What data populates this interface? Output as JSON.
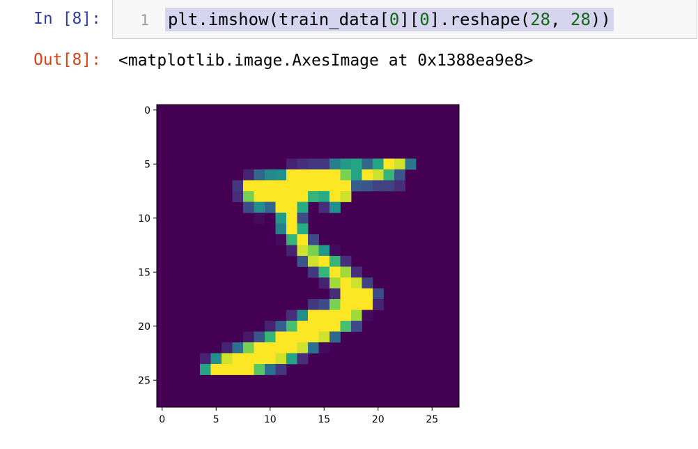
{
  "cell": {
    "in_prompt": "In [8]:",
    "line_number": "1",
    "code_tokens": [
      {
        "t": "plt.imshow(train_data[",
        "c": ""
      },
      {
        "t": "0",
        "c": "num"
      },
      {
        "t": "][",
        "c": ""
      },
      {
        "t": "0",
        "c": "num"
      },
      {
        "t": "].reshape(",
        "c": ""
      },
      {
        "t": "28",
        "c": "num"
      },
      {
        "t": ", ",
        "c": ""
      },
      {
        "t": "28",
        "c": "num"
      },
      {
        "t": "))",
        "c": ""
      }
    ],
    "out_prompt": "Out[8]:",
    "output_text": "<matplotlib.image.AxesImage at 0x1388ea9e8>"
  },
  "colors": {
    "in_prompt": "#303F9F",
    "out_prompt": "#D84315",
    "code_bg": "#f7f7f7",
    "selection": "#d7d4f0",
    "number": "#116611"
  },
  "chart_data": {
    "type": "heatmap",
    "colormap": "viridis",
    "rows": 28,
    "cols": 28,
    "xticks": [
      "0",
      "5",
      "10",
      "15",
      "20",
      "25"
    ],
    "yticks": [
      "0",
      "5",
      "10",
      "15",
      "20",
      "25"
    ],
    "xlim": [
      -0.5,
      27.5
    ],
    "ylim": [
      27.5,
      -0.5
    ],
    "pixel_rows": [
      "............................",
      "............................",
      "............................",
      "............................",
      "............................",
      "............................",
      "...............................",
      "............................",
      "............................",
      "............................",
      "............................",
      "............................",
      "............................",
      "............................",
      "............................",
      "............................",
      "............................",
      "............................",
      "............................",
      "............................",
      "............................",
      "............................",
      "............................",
      "............................",
      "............................",
      "............................",
      "............................",
      "............................"
    ],
    "values": [
      [
        0,
        0,
        0,
        0,
        0,
        0,
        0,
        0,
        0,
        0,
        0,
        0,
        0,
        0,
        0,
        0,
        0,
        0,
        0,
        0,
        0,
        0,
        0,
        0,
        0,
        0,
        0,
        0
      ],
      [
        0,
        0,
        0,
        0,
        0,
        0,
        0,
        0,
        0,
        0,
        0,
        0,
        0,
        0,
        0,
        0,
        0,
        0,
        0,
        0,
        0,
        0,
        0,
        0,
        0,
        0,
        0,
        0
      ],
      [
        0,
        0,
        0,
        0,
        0,
        0,
        0,
        0,
        0,
        0,
        0,
        0,
        0,
        0,
        0,
        0,
        0,
        0,
        0,
        0,
        0,
        0,
        0,
        0,
        0,
        0,
        0,
        0
      ],
      [
        0,
        0,
        0,
        0,
        0,
        0,
        0,
        0,
        0,
        0,
        0,
        0,
        0,
        0,
        0,
        0,
        0,
        0,
        0,
        0,
        0,
        0,
        0,
        0,
        0,
        0,
        0,
        0
      ],
      [
        0,
        0,
        0,
        0,
        0,
        0,
        0,
        0,
        0,
        0,
        0,
        0,
        0,
        0,
        0,
        0,
        0,
        0,
        0,
        0,
        0,
        0,
        0,
        0,
        0,
        0,
        0,
        0
      ],
      [
        0,
        0,
        0,
        0,
        0,
        0,
        0,
        0,
        0,
        0,
        0,
        0,
        3,
        4,
        5,
        5,
        13,
        16,
        17,
        10,
        17,
        25,
        24,
        12,
        0,
        0,
        0,
        0
      ],
      [
        0,
        0,
        0,
        0,
        0,
        0,
        0,
        0,
        3,
        10,
        14,
        15,
        25,
        25,
        25,
        25,
        25,
        22,
        17,
        25,
        24,
        19,
        8,
        0,
        0,
        0,
        0,
        0
      ],
      [
        0,
        0,
        0,
        0,
        0,
        0,
        0,
        5,
        25,
        25,
        25,
        25,
        25,
        25,
        25,
        25,
        25,
        25,
        9,
        8,
        6,
        6,
        4,
        0,
        0,
        0,
        0,
        0
      ],
      [
        0,
        0,
        0,
        0,
        0,
        0,
        0,
        4,
        22,
        25,
        25,
        25,
        25,
        25,
        19,
        18,
        25,
        24,
        0,
        0,
        0,
        0,
        0,
        0,
        0,
        0,
        0,
        0
      ],
      [
        0,
        0,
        0,
        0,
        0,
        0,
        0,
        0,
        7,
        15,
        10,
        25,
        25,
        18,
        0,
        4,
        15,
        0,
        0,
        0,
        0,
        0,
        0,
        0,
        0,
        0,
        0,
        0
      ],
      [
        0,
        0,
        0,
        0,
        0,
        0,
        0,
        0,
        0,
        1,
        0,
        16,
        25,
        7,
        0,
        0,
        0,
        0,
        0,
        0,
        0,
        0,
        0,
        0,
        0,
        0,
        0,
        0
      ],
      [
        0,
        0,
        0,
        0,
        0,
        0,
        0,
        0,
        0,
        0,
        0,
        13,
        25,
        18,
        0,
        0,
        0,
        0,
        0,
        0,
        0,
        0,
        0,
        0,
        0,
        0,
        0,
        0
      ],
      [
        0,
        0,
        0,
        0,
        0,
        0,
        0,
        0,
        0,
        0,
        0,
        1,
        19,
        25,
        7,
        0,
        0,
        0,
        0,
        0,
        0,
        0,
        0,
        0,
        0,
        0,
        0,
        0
      ],
      [
        0,
        0,
        0,
        0,
        0,
        0,
        0,
        0,
        0,
        0,
        0,
        0,
        3,
        24,
        22,
        16,
        1,
        0,
        0,
        0,
        0,
        0,
        0,
        0,
        0,
        0,
        0,
        0
      ],
      [
        0,
        0,
        0,
        0,
        0,
        0,
        0,
        0,
        0,
        0,
        0,
        0,
        0,
        8,
        24,
        25,
        19,
        4,
        0,
        0,
        0,
        0,
        0,
        0,
        0,
        0,
        0,
        0
      ],
      [
        0,
        0,
        0,
        0,
        0,
        0,
        0,
        0,
        0,
        0,
        0,
        0,
        0,
        0,
        5,
        19,
        25,
        23,
        4,
        0,
        0,
        0,
        0,
        0,
        0,
        0,
        0,
        0
      ],
      [
        0,
        0,
        0,
        0,
        0,
        0,
        0,
        0,
        0,
        0,
        0,
        0,
        0,
        0,
        0,
        3,
        23,
        25,
        24,
        6,
        0,
        0,
        0,
        0,
        0,
        0,
        0,
        0
      ],
      [
        0,
        0,
        0,
        0,
        0,
        0,
        0,
        0,
        0,
        0,
        0,
        0,
        0,
        0,
        0,
        0,
        4,
        25,
        25,
        25,
        7,
        0,
        0,
        0,
        0,
        0,
        0,
        0
      ],
      [
        0,
        0,
        0,
        0,
        0,
        0,
        0,
        0,
        0,
        0,
        0,
        0,
        0,
        0,
        5,
        7,
        22,
        25,
        25,
        25,
        3,
        0,
        0,
        0,
        0,
        0,
        0,
        0
      ],
      [
        0,
        0,
        0,
        0,
        0,
        0,
        0,
        0,
        0,
        0,
        0,
        0,
        4,
        15,
        25,
        25,
        25,
        25,
        23,
        1,
        0,
        0,
        0,
        0,
        0,
        0,
        0,
        0
      ],
      [
        0,
        0,
        0,
        0,
        0,
        0,
        0,
        0,
        0,
        0,
        3,
        9,
        20,
        25,
        25,
        25,
        25,
        20,
        7,
        0,
        0,
        0,
        0,
        0,
        0,
        0,
        0,
        0
      ],
      [
        0,
        0,
        0,
        0,
        0,
        0,
        0,
        0,
        2,
        8,
        19,
        25,
        25,
        25,
        25,
        24,
        10,
        0,
        0,
        0,
        0,
        0,
        0,
        0,
        0,
        0,
        0,
        0
      ],
      [
        0,
        0,
        0,
        0,
        0,
        0,
        3,
        11,
        22,
        25,
        25,
        25,
        25,
        24,
        11,
        1,
        0,
        0,
        0,
        0,
        0,
        0,
        0,
        0,
        0,
        0,
        0,
        0
      ],
      [
        0,
        0,
        0,
        0,
        3,
        15,
        24,
        25,
        25,
        25,
        25,
        24,
        17,
        4,
        0,
        0,
        0,
        0,
        0,
        0,
        0,
        0,
        0,
        0,
        0,
        0,
        0,
        0
      ],
      [
        0,
        0,
        0,
        0,
        17,
        25,
        25,
        25,
        25,
        21,
        11,
        5,
        0,
        0,
        0,
        0,
        0,
        0,
        0,
        0,
        0,
        0,
        0,
        0,
        0,
        0,
        0,
        0
      ],
      [
        0,
        0,
        0,
        0,
        0,
        0,
        0,
        0,
        0,
        0,
        0,
        0,
        0,
        0,
        0,
        0,
        0,
        0,
        0,
        0,
        0,
        0,
        0,
        0,
        0,
        0,
        0,
        0
      ],
      [
        0,
        0,
        0,
        0,
        0,
        0,
        0,
        0,
        0,
        0,
        0,
        0,
        0,
        0,
        0,
        0,
        0,
        0,
        0,
        0,
        0,
        0,
        0,
        0,
        0,
        0,
        0,
        0
      ],
      [
        0,
        0,
        0,
        0,
        0,
        0,
        0,
        0,
        0,
        0,
        0,
        0,
        0,
        0,
        0,
        0,
        0,
        0,
        0,
        0,
        0,
        0,
        0,
        0,
        0,
        0,
        0,
        0
      ]
    ],
    "value_max": 25
  }
}
